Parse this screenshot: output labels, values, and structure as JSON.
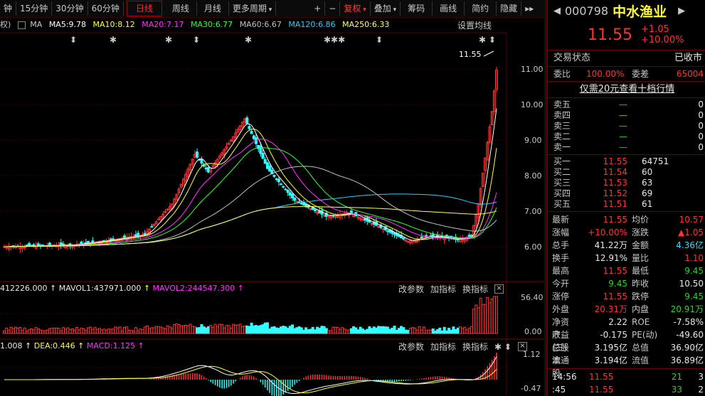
{
  "toolbar": {
    "periods": [
      "钟",
      "15分钟",
      "30分钟",
      "60分钟",
      "日线",
      "周线",
      "月线",
      "更多周期"
    ],
    "active": "日线",
    "buttons": {
      "plus": "+",
      "minus": "−",
      "fuquan": "复权",
      "diejia": "叠加",
      "chouma": "筹码",
      "huaxian": "画线",
      "jianyue": "简约",
      "yincang": "隐藏"
    }
  },
  "ma_legend": {
    "prefix": "权)",
    "ma": "MA",
    "ma5": "MA5:9.78",
    "ma10": "MA10:8.12",
    "ma20": "MA20:7.17",
    "ma30": "MA30:6.77",
    "ma60": "MA60:6.67",
    "ma120": "MA120:6.86",
    "ma250": "MA250:6.33",
    "settings": "设置均线"
  },
  "colors": {
    "ma5": "#ffffff",
    "ma10": "#ffff33",
    "ma20": "#ff33ff",
    "ma30": "#33ff33",
    "ma60": "#c0c0c0",
    "ma120": "#33ccff",
    "ma250": "#ffff66",
    "up": "#ff3333",
    "down": "#33ffff",
    "bg": "#000000"
  },
  "price_axis": {
    "labels": [
      "11.00",
      "10.00",
      "9.00",
      "8.00",
      "7.00",
      "6.00"
    ],
    "current": "11.55"
  },
  "volume_panel": {
    "legend": {
      "vol": "412226.000",
      "mavol1": "MAVOL1:437971.000",
      "mavol2": "MAVOL2:244547.300"
    },
    "axis": [
      "56.40",
      "0.00"
    ],
    "actions": [
      "改参数",
      "加指标",
      "换指标"
    ]
  },
  "macd_panel": {
    "legend": {
      "dif": "1.008",
      "dea": "DEA:0.446",
      "macd": "MACD:1.125"
    },
    "axis": [
      "1.12",
      "-0.47"
    ],
    "actions": [
      "改参数",
      "加指标",
      "换指标"
    ]
  },
  "stock": {
    "code": "000798",
    "name": "中水渔业",
    "price": "11.55",
    "change": "+1.05",
    "pct": "+10.00%"
  },
  "status": {
    "label": "交易状态",
    "value": "已收市"
  },
  "weibi": {
    "label": "委比",
    "value": "100.00%",
    "diff_label": "委差",
    "diff": "65004"
  },
  "level10_link": "仅需20元查看十档行情",
  "sells": [
    {
      "label": "卖五",
      "price": "—",
      "vol": "0"
    },
    {
      "label": "卖四",
      "price": "—",
      "vol": "0"
    },
    {
      "label": "卖三",
      "price": "—",
      "vol": "0"
    },
    {
      "label": "卖二",
      "price": "—",
      "vol": "0"
    },
    {
      "label": "卖一",
      "price": "—",
      "vol": "0"
    }
  ],
  "buys": [
    {
      "label": "买一",
      "price": "11.55",
      "vol": "64751"
    },
    {
      "label": "买二",
      "price": "11.54",
      "vol": "60"
    },
    {
      "label": "买三",
      "price": "11.53",
      "vol": "63"
    },
    {
      "label": "买四",
      "price": "11.52",
      "vol": "69"
    },
    {
      "label": "买五",
      "price": "11.51",
      "vol": "61"
    }
  ],
  "stats": [
    {
      "k1": "最新",
      "v1": "11.55",
      "k2": "均价",
      "v2": "10.57",
      "c1": "red",
      "c2": "red"
    },
    {
      "k1": "涨幅",
      "v1": "+10.00%",
      "k2": "涨跌",
      "v2": "▲1.05",
      "c1": "red",
      "c2": "red"
    },
    {
      "k1": "总手",
      "v1": "41.22万",
      "k2": "金额",
      "v2": "4.36亿",
      "c1": "white",
      "c2": "cyan"
    },
    {
      "k1": "换手",
      "v1": "12.91%",
      "k2": "量比",
      "v2": "1.10",
      "c1": "white",
      "c2": "red"
    },
    {
      "k1": "最高",
      "v1": "11.55",
      "k2": "最低",
      "v2": "9.45",
      "c1": "red",
      "c2": "green"
    },
    {
      "k1": "今开",
      "v1": "9.45",
      "k2": "昨收",
      "v2": "10.50",
      "c1": "green",
      "c2": "white"
    },
    {
      "k1": "涨停",
      "v1": "11.55",
      "k2": "跌停",
      "v2": "9.45",
      "c1": "red",
      "c2": "green"
    },
    {
      "k1": "外盘",
      "v1": "20.31万",
      "k2": "内盘",
      "v2": "20.91万",
      "c1": "red",
      "c2": "green"
    },
    {
      "k1": "净资产",
      "v1": "2.22",
      "k2": "ROE",
      "v2": "-7.58%",
      "c1": "white",
      "c2": "white"
    },
    {
      "k1": "收益(三)",
      "v1": "-0.175",
      "k2": "PE(动)",
      "v2": "-49.60",
      "c1": "white",
      "c2": "white"
    },
    {
      "k1": "总股本",
      "v1": "3.195亿",
      "k2": "总值",
      "v2": "36.90亿",
      "c1": "white",
      "c2": "white"
    },
    {
      "k1": "流通股",
      "v1": "3.194亿",
      "k2": "流值",
      "v2": "36.89亿",
      "c1": "white",
      "c2": "white"
    }
  ],
  "ticks": [
    {
      "time": "14:56",
      "price": "11.55",
      "vol": "21",
      "flag": "3"
    },
    {
      "time": ":45",
      "price": "11.55",
      "vol": "33",
      "flag": "2"
    }
  ]
}
